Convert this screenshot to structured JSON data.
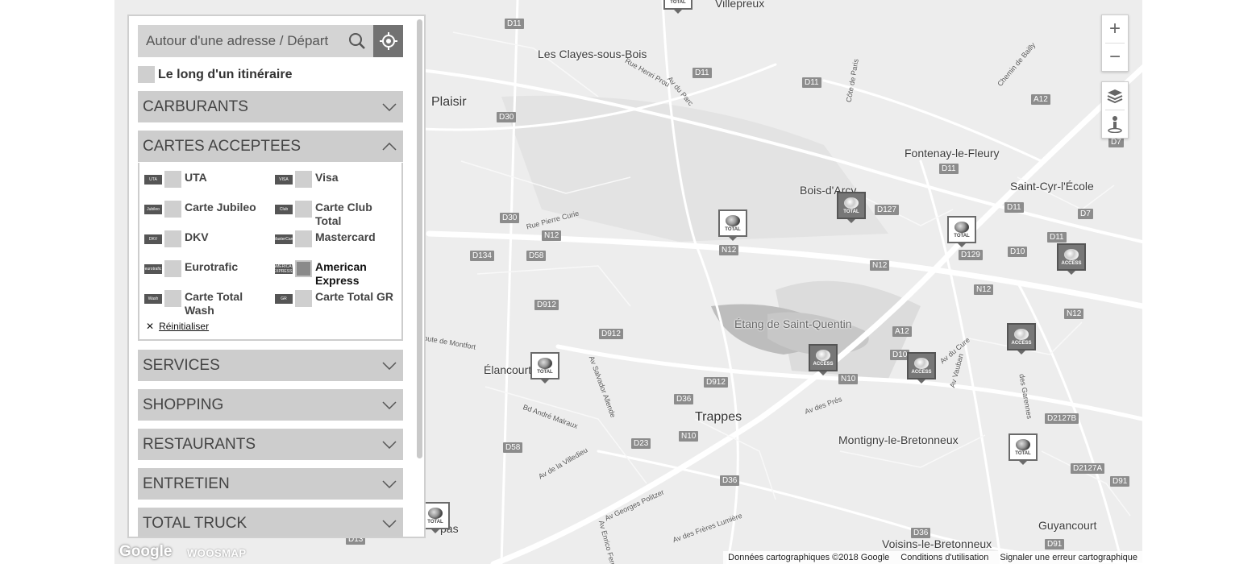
{
  "search": {
    "placeholder": "Autour d'une adresse / Départ",
    "search_icon": "search-icon",
    "locate_icon": "crosshair-icon"
  },
  "itinerary": {
    "label": "Le long d'un itinéraire",
    "checked": false
  },
  "sections": {
    "carburants": "CARBURANTS",
    "cartes": "CARTES ACCEPTEES",
    "services": "SERVICES",
    "shopping": "SHOPPING",
    "restaurants": "RESTAURANTS",
    "entretien": "ENTRETIEN",
    "truck": "TOTAL TRUCK"
  },
  "cards": [
    {
      "label": "UTA",
      "logo": "UTA",
      "checked": false
    },
    {
      "label": "Visa",
      "logo": "VISA",
      "checked": false
    },
    {
      "label": "Carte Jubileo",
      "logo": "Jubileo",
      "checked": false
    },
    {
      "label": "Carte Club Total",
      "logo": "Club",
      "checked": false
    },
    {
      "label": "DKV",
      "logo": "DKV",
      "checked": false
    },
    {
      "label": "Mastercard",
      "logo": "MasterCard",
      "checked": false
    },
    {
      "label": "Eurotrafic",
      "logo": "eurotrafic",
      "checked": false
    },
    {
      "label": "American Express",
      "logo": "AMERICAN EXPRESS",
      "checked": true
    },
    {
      "label": "Carte Total Wash",
      "logo": "Wash",
      "checked": false
    },
    {
      "label": "Carte Total GR",
      "logo": "GR",
      "checked": false
    }
  ],
  "reset": {
    "icon": "close-icon",
    "label": "Réinitialiser"
  },
  "map": {
    "places": {
      "villepreux": "Villepreux",
      "clayes": "Les Clayes-sous-Bois",
      "plaisir": "Plaisir",
      "fontenay": "Fontenay-le-Fleury",
      "boisdarcy": "Bois-d'Arcy",
      "saintcyr": "Saint-Cyr-l'École",
      "etang": "Étang de Saint-Quentin",
      "elancourt": "Élancourt",
      "trappes": "Trappes",
      "montigny": "Montigny-le-Bretonneux",
      "voisins": "Voisins-le-Bretonneux",
      "guyancourt": "Guyancourt",
      "maurepas": "pas"
    },
    "streets": {
      "henri": "Rue Henri Prou",
      "parc": "Av du Parc",
      "paris": "Côte de Paris",
      "bailly": "Chemin de Bailly",
      "curie": "Rue Pierre Curie",
      "montfort": "oute de Montfort",
      "salvador": "Av Salvador Allende",
      "malraux": "Bd André Malraux",
      "villedieu": "Av de la Villedieu",
      "politzer": "Av Georges Politzer",
      "fermi": "Av Enrico Fermi",
      "lumiere": "Av des Frères Lumière",
      "pres": "Av des Prés",
      "cure": "Av du Cure",
      "vauban": "Av Vauban",
      "garennes": "des Garennes"
    },
    "shields": {
      "d11a": "D11",
      "d11b": "D11",
      "d11c": "D11",
      "d11d": "D11",
      "d11e": "D11",
      "d11f": "D11",
      "d30a": "D30",
      "d30b": "D30",
      "a12a": "A12",
      "a12b": "A12",
      "d7a": "D7",
      "d7b": "D7",
      "n12a": "N12",
      "n12b": "N12",
      "n12c": "N12",
      "n12d": "N12",
      "n12e": "N12",
      "d127": "D127",
      "d129": "D129",
      "d10a": "D10",
      "d10b": "D10",
      "d134": "D134",
      "d58a": "D58",
      "d58b": "D58",
      "d912a": "D912",
      "d912b": "D912",
      "d912c": "D912",
      "n10a": "N10",
      "n10b": "N10",
      "d36a": "D36",
      "d36b": "D36",
      "d36c": "D36",
      "d23": "D23",
      "d2127b": "D2127B",
      "d2127a": "D2127A",
      "d91a": "D91",
      "d91b": "D91",
      "d13": "D13"
    },
    "marker_total": "TOTAL",
    "marker_access": "ACCESS",
    "zoom_in": "+",
    "zoom_out": "−",
    "layers_icon": "layers-icon",
    "pegman_icon": "street-view-icon"
  },
  "footer": {
    "data": "Données cartographiques ©2018 Google",
    "terms": "Conditions d'utilisation",
    "report": "Signaler une erreur cartographique"
  },
  "brands": {
    "google": "Google",
    "woosmap": "WOOSMAP"
  }
}
